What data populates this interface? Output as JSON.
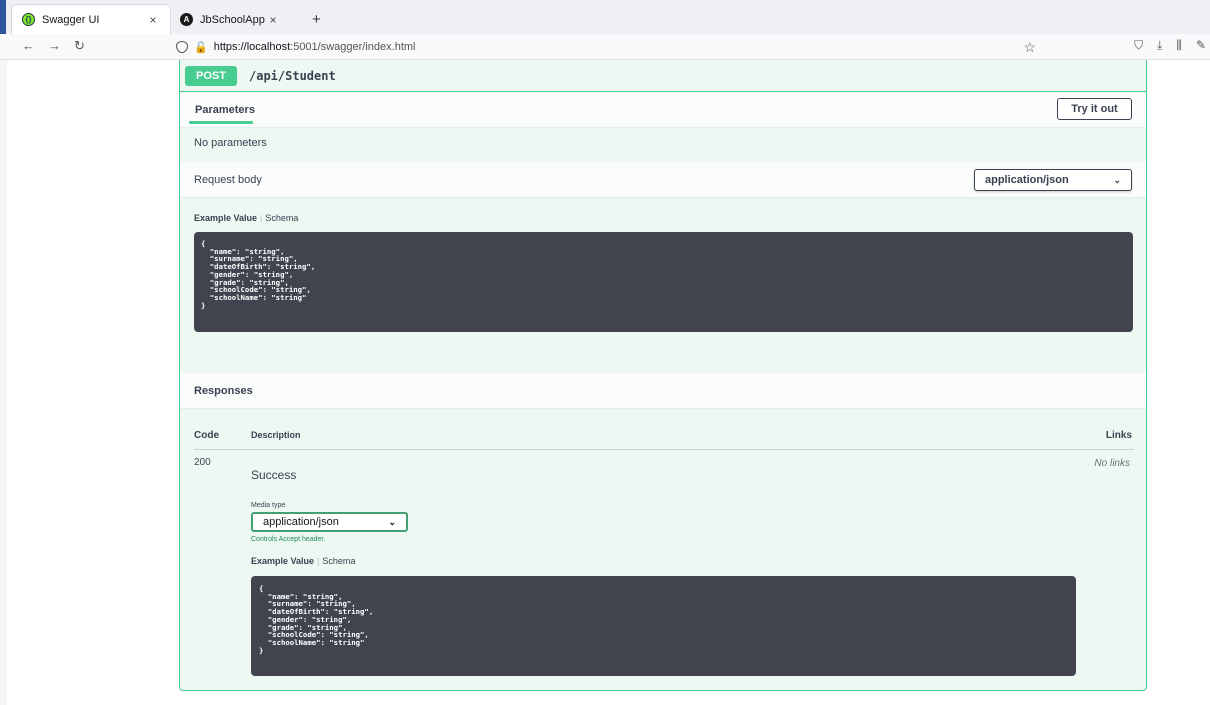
{
  "browser": {
    "tabs": [
      {
        "label": "Swagger UI",
        "active": true,
        "icon": "swagger-icon"
      },
      {
        "label": "JbSchoolApp",
        "active": false,
        "icon": "angular-icon"
      }
    ],
    "tab_close": "×",
    "new_tab": "+",
    "url_host": "https://localhost",
    "url_rest": ":5001/swagger/index.html",
    "accent": "#2b579a"
  },
  "operation": {
    "method": "POST",
    "path": "/api/Student",
    "method_color": "#49cc90",
    "parameters_title": "Parameters",
    "try_it_out": "Try it out",
    "no_parameters": "No parameters",
    "request_body_title": "Request body",
    "request_content_type": "application/json",
    "example_value_tab": "Example Value",
    "schema_tab": "Schema",
    "request_example": "{\n  \"name\": \"string\",\n  \"surname\": \"string\",\n  \"dateOfBirth\": \"string\",\n  \"gender\": \"string\",\n  \"grade\": \"string\",\n  \"schoolCode\": \"string\",\n  \"schoolName\": \"string\"\n}"
  },
  "responses": {
    "title": "Responses",
    "headers": {
      "code": "Code",
      "description": "Description",
      "links": "Links"
    },
    "rows": [
      {
        "code": "200",
        "description": "Success",
        "links": "No links",
        "media_type_label": "Media type",
        "media_type": "application/json",
        "accept_note": "Controls Accept header.",
        "example_value_tab": "Example Value",
        "schema_tab": "Schema",
        "example": "{\n  \"name\": \"string\",\n  \"surname\": \"string\",\n  \"dateOfBirth\": \"string\",\n  \"gender\": \"string\",\n  \"grade\": \"string\",\n  \"schoolCode\": \"string\",\n  \"schoolName\": \"string\"\n}"
      }
    ]
  }
}
